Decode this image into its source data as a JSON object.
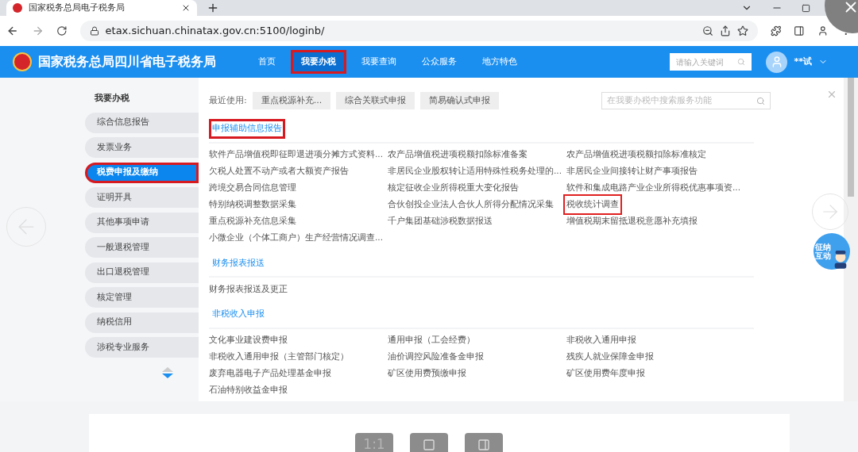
{
  "browser": {
    "tab_title": "国家税务总局电子税务局",
    "url": "etax.sichuan.chinatax.gov.cn:5100/loginb/"
  },
  "header": {
    "site_title": "国家税务总局四川省电子税务局",
    "nav": [
      {
        "label": "首页",
        "selected": false,
        "highlighted": false
      },
      {
        "label": "我要办税",
        "selected": true,
        "highlighted": true
      },
      {
        "label": "我要查询",
        "selected": false,
        "highlighted": false
      },
      {
        "label": "公众服务",
        "selected": false,
        "highlighted": false
      },
      {
        "label": "地方特色",
        "selected": false,
        "highlighted": false
      }
    ],
    "search_placeholder": "请输入关键词",
    "user": "**试"
  },
  "sidebar": {
    "title": "我要办税",
    "items": [
      {
        "label": "综合信息报告",
        "selected": false,
        "highlighted": false
      },
      {
        "label": "发票业务",
        "selected": false,
        "highlighted": false
      },
      {
        "label": "税费申报及缴纳",
        "selected": true,
        "highlighted": true
      },
      {
        "label": "证明开具",
        "selected": false,
        "highlighted": false
      },
      {
        "label": "其他事项申请",
        "selected": false,
        "highlighted": false
      },
      {
        "label": "一般退税管理",
        "selected": false,
        "highlighted": false
      },
      {
        "label": "出口退税管理",
        "selected": false,
        "highlighted": false
      },
      {
        "label": "核定管理",
        "selected": false,
        "highlighted": false
      },
      {
        "label": "纳税信用",
        "selected": false,
        "highlighted": false
      },
      {
        "label": "涉税专业服务",
        "selected": false,
        "highlighted": false
      }
    ]
  },
  "recent": {
    "label": "最近使用:",
    "buttons": [
      "重点税源补充...",
      "综合关联式申报",
      "简易确认式申报"
    ]
  },
  "service_search_placeholder": "在我要办税中搜索服务功能",
  "sections": [
    {
      "title": "申报辅助信息报告",
      "highlighted": true,
      "items": [
        {
          "label": "软件产品增值税即征即退进项分摊方式资料...",
          "highlighted": false
        },
        {
          "label": "农产品增值税进项税额扣除标准备案",
          "highlighted": false
        },
        {
          "label": "农产品增值税进项税额扣除标准核定",
          "highlighted": false
        },
        {
          "label": "欠税人处置不动产或者大额资产报告",
          "highlighted": false
        },
        {
          "label": "非居民企业股权转让适用特殊性税务处理的...",
          "highlighted": false
        },
        {
          "label": "非居民企业间接转让财产事项报告",
          "highlighted": false
        },
        {
          "label": "跨境交易合同信息管理",
          "highlighted": false
        },
        {
          "label": "核定征收企业所得税重大变化报告",
          "highlighted": false
        },
        {
          "label": "软件和集成电路产业企业所得税优惠事项资...",
          "highlighted": false
        },
        {
          "label": "特别纳税调整数据采集",
          "highlighted": false
        },
        {
          "label": "合伙创投企业法人合伙人所得分配情况采集",
          "highlighted": false
        },
        {
          "label": "税收统计调查",
          "highlighted": true
        },
        {
          "label": "重点税源补充信息采集",
          "highlighted": false
        },
        {
          "label": "千户集团基础涉税数据报送",
          "highlighted": false
        },
        {
          "label": "增值税期末留抵退税意愿补充填报",
          "highlighted": false
        },
        {
          "label": "小微企业（个体工商户）生产经营情况调查...",
          "highlighted": false
        }
      ]
    },
    {
      "title": "财务报表报送",
      "highlighted": false,
      "items": [
        {
          "label": "财务报表报送及更正",
          "highlighted": false
        }
      ]
    },
    {
      "title": "非税收入申报",
      "highlighted": false,
      "items": [
        {
          "label": "文化事业建设费申报",
          "highlighted": false
        },
        {
          "label": "通用申报（工会经费）",
          "highlighted": false
        },
        {
          "label": "非税收入通用申报",
          "highlighted": false
        },
        {
          "label": "非税收入通用申报（主管部门核定）",
          "highlighted": false
        },
        {
          "label": "油价调控风险准备金申报",
          "highlighted": false
        },
        {
          "label": "残疾人就业保障金申报",
          "highlighted": false
        },
        {
          "label": "废弃电器电子产品处理基金申报",
          "highlighted": false
        },
        {
          "label": "矿区使用费预缴申报",
          "highlighted": false
        },
        {
          "label": "矿区使用费年度申报",
          "highlighted": false
        },
        {
          "label": "石油特别收益金申报",
          "highlighted": false
        }
      ]
    }
  ],
  "assistant": {
    "label": "征纳互动"
  },
  "viewer": {
    "zoom_label": "1:1"
  }
}
